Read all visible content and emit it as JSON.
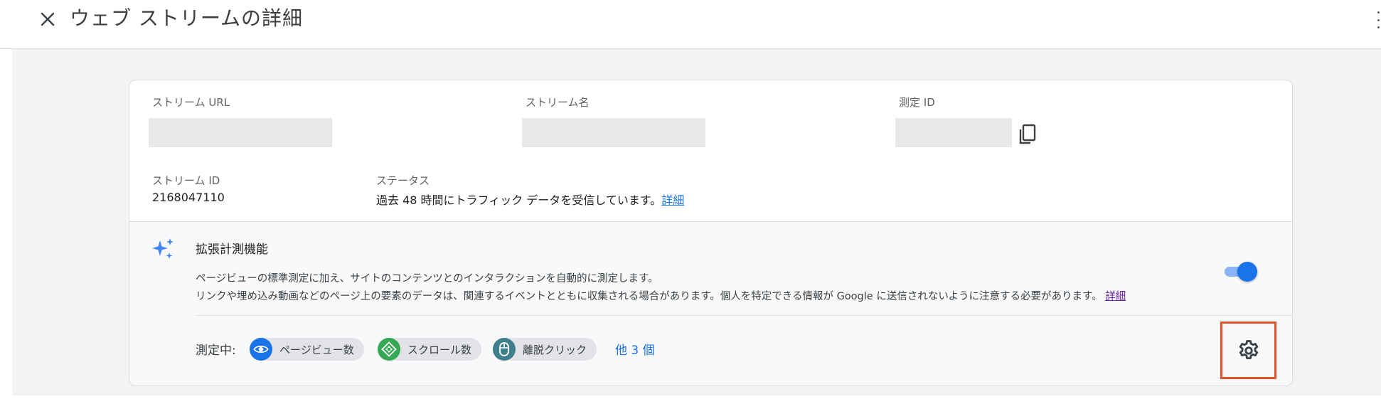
{
  "header": {
    "title": "ウェブ ストリームの詳細",
    "close_icon": "close-icon",
    "more_icon": "more-vert-icon"
  },
  "stream": {
    "url_label": "ストリーム URL",
    "name_label": "ストリーム名",
    "measurement_id_label": "測定 ID",
    "copy_icon": "copy-icon",
    "stream_id_label": "ストリーム ID",
    "stream_id_value": "2168047110",
    "status_label": "ステータス",
    "status_text": "過去 48 時間にトラフィック データを受信しています。",
    "status_link": "詳細"
  },
  "enhanced": {
    "icon": "sparkle-icon",
    "title": "拡張計測機能",
    "desc_line1": "ページビューの標準測定に加え、サイトのコンテンツとのインタラクションを自動的に測定します。",
    "desc_line2": "リンクや埋め込み動画などのページ上の要素のデータは、関連するイベントとともに収集される場合があります。個人を特定できる情報が Google に送信されないように注意する必要があります。",
    "desc_link": "詳細",
    "toggle_on": true,
    "measuring_label": "測定中:",
    "chips": [
      {
        "label": "ページビュー数",
        "icon": "eye-icon",
        "color": "#1a73e8"
      },
      {
        "label": "スクロール数",
        "icon": "scroll-icon",
        "color": "#34a853"
      },
      {
        "label": "離脱クリック",
        "icon": "mouse-icon",
        "color": "#3f7f8c"
      }
    ],
    "more_link": "他 3 個",
    "settings_icon": "gear-icon",
    "highlight_color": "#e0542e"
  }
}
